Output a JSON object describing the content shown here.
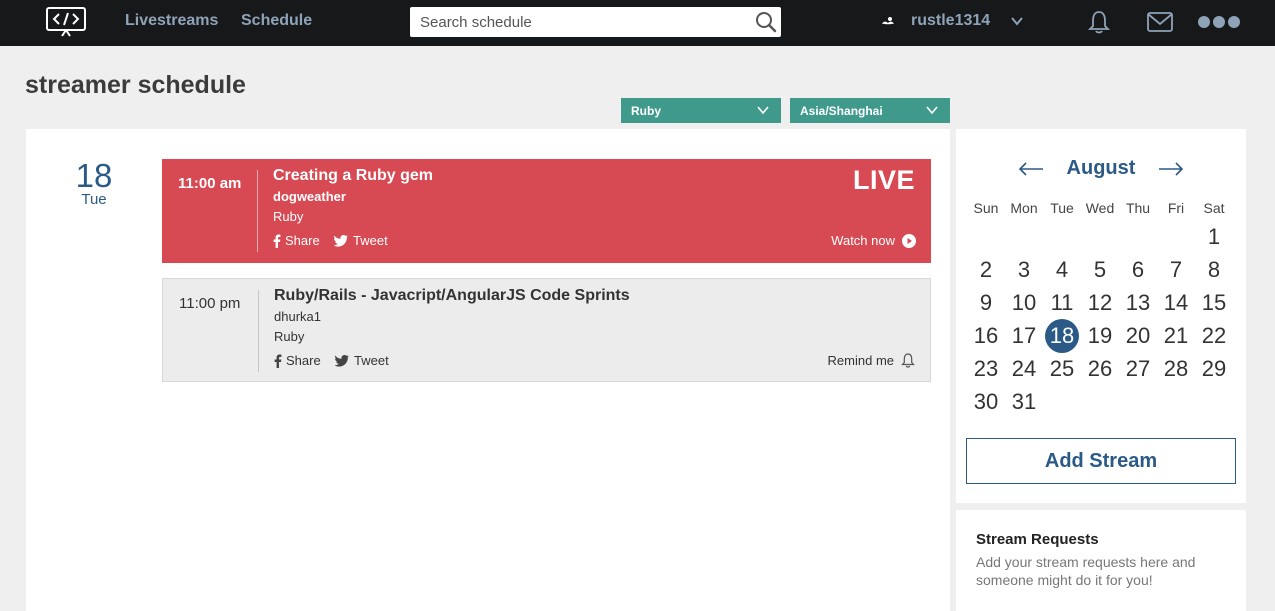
{
  "nav": {
    "links": [
      "Livestreams",
      "Schedule"
    ],
    "search_placeholder": "Search schedule",
    "username": "rustle1314"
  },
  "page": {
    "title": "streamer schedule"
  },
  "filters": {
    "language": "Ruby",
    "timezone": "Asia/Shanghai"
  },
  "day": {
    "date": "18",
    "weekday": "Tue"
  },
  "events": [
    {
      "time": "11:00 am",
      "title": "Creating a Ruby gem",
      "streamer": "dogweather",
      "language": "Ruby",
      "share_label": "Share",
      "tweet_label": "Tweet",
      "badge": "LIVE",
      "action_label": "Watch now",
      "status": "live"
    },
    {
      "time": "11:00 pm",
      "title": "Ruby/Rails - Javacript/AngularJS Code Sprints",
      "streamer": "dhurka1",
      "language": "Ruby",
      "share_label": "Share",
      "tweet_label": "Tweet",
      "action_label": "Remind me",
      "status": "upcoming"
    }
  ],
  "calendar": {
    "month": "August",
    "weekdays": [
      "Sun",
      "Mon",
      "Tue",
      "Wed",
      "Thu",
      "Fri",
      "Sat"
    ],
    "days": [
      "1",
      "2",
      "3",
      "4",
      "5",
      "6",
      "7",
      "8",
      "9",
      "10",
      "11",
      "12",
      "13",
      "14",
      "15",
      "16",
      "17",
      "18",
      "19",
      "20",
      "21",
      "22",
      "23",
      "24",
      "25",
      "26",
      "27",
      "28",
      "29",
      "30",
      "31"
    ],
    "first_weekday_index": 6,
    "selected_day": "18",
    "add_stream_label": "Add Stream"
  },
  "requests": {
    "title": "Stream Requests",
    "text": "Add your stream requests here and someone might do it for you!"
  },
  "colors": {
    "nav_bg": "#17181a",
    "nav_link": "#8ea3b8",
    "accent_blue": "#2b5a86",
    "filter_teal": "#3f9a8c",
    "live_red": "#d84a53"
  }
}
